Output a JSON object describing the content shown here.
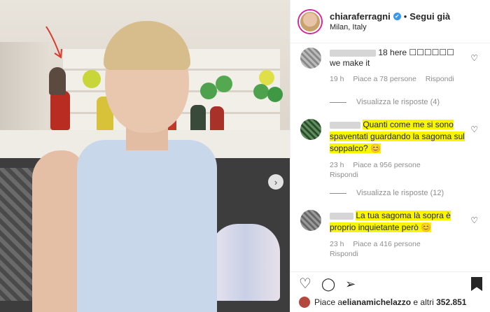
{
  "post": {
    "username": "chiaraferragni",
    "verified_mark": "✔",
    "separator": "•",
    "follow_label": "Segui già",
    "location": "Milan, Italy"
  },
  "comments": [
    {
      "text_a": "18 here ☐☐☐☐☐☐",
      "text_b": "we make it",
      "time": "19 h",
      "likes": "Piace a 78 persone",
      "reply": "Rispondi",
      "view_replies": "Visualizza le risposte (4)",
      "highlighted": false
    },
    {
      "text": "Quanti come me si sono spaventati guardando la sagoma sul soppalco? 😊",
      "time": "23 h",
      "likes": "Piace a 956 persone",
      "reply": "Rispondi",
      "view_replies": "Visualizza le risposte (12)",
      "highlighted": true
    },
    {
      "text": "La tua sagoma là sopra è proprio inquietante però 😊",
      "time": "23 h",
      "likes": "Piace a 416 persone",
      "reply": "Rispondi",
      "highlighted": true
    }
  ],
  "likes_line": {
    "prefix": "Piace a ",
    "user": "elianamichelazzo",
    "suffix": " e altri ",
    "count": "352.851"
  },
  "icons": {
    "heart": "♡",
    "comment": "◯",
    "share": "➢",
    "next": "›"
  },
  "colors": {
    "highlight": "#f8f500",
    "verified": "#3897f0",
    "annotation_arrow": "#d93a2b"
  }
}
